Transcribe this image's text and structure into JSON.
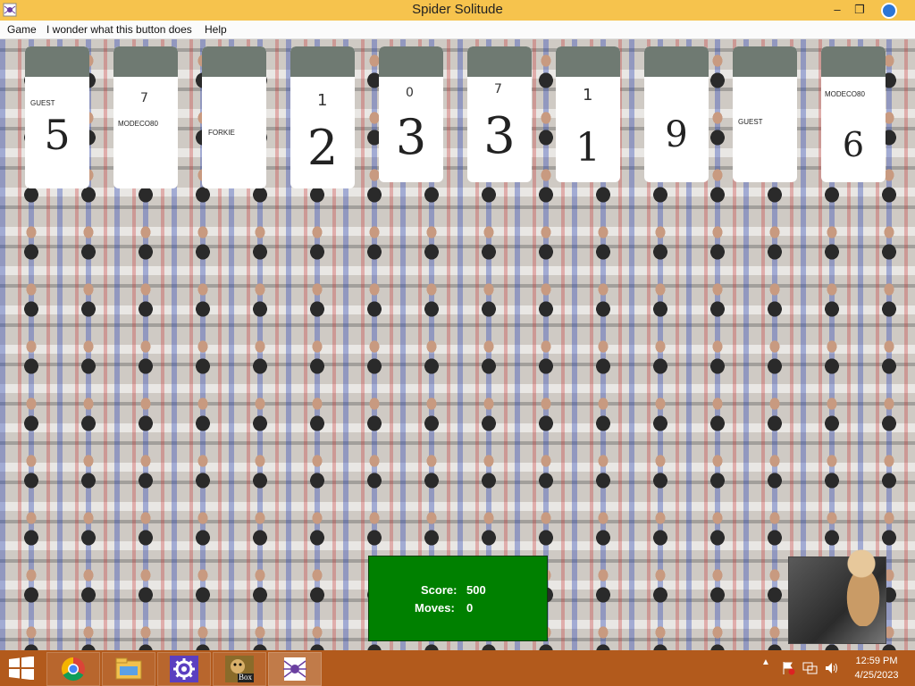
{
  "window": {
    "title": "Spider Solitude",
    "minimize": "‒",
    "maximize": "❐"
  },
  "menu": {
    "items": [
      "Game",
      "I wonder what this button does",
      "Help"
    ]
  },
  "cards": [
    {
      "name": "GUEST",
      "number": "5",
      "top_mark": ""
    },
    {
      "name": "MODECO80",
      "number": "",
      "top_mark": "7"
    },
    {
      "name": "FORKIE",
      "number": "",
      "top_mark": ""
    },
    {
      "name": "",
      "number": "2",
      "top_mark": "1"
    },
    {
      "name": "",
      "number": "3",
      "top_mark": "0"
    },
    {
      "name": "",
      "number": "3",
      "top_mark": "7"
    },
    {
      "name": "",
      "number": "1",
      "top_mark": "1"
    },
    {
      "name": "",
      "number": "9",
      "top_mark": ""
    },
    {
      "name": "GUEST",
      "number": "",
      "top_mark": ""
    },
    {
      "name": "MODECO80",
      "number": "6",
      "top_mark": ""
    }
  ],
  "score": {
    "score_label": "Score:",
    "score_value": "500",
    "moves_label": "Moves:",
    "moves_value": "0"
  },
  "taskbar": {
    "apps": [
      {
        "icon": "chrome-icon"
      },
      {
        "icon": "file-explorer-icon"
      },
      {
        "icon": "settings-icon"
      },
      {
        "icon": "box-app-icon",
        "label": "Box"
      },
      {
        "icon": "spider-solitude-icon"
      }
    ],
    "time": "12:59 PM",
    "date": "4/25/2023"
  },
  "colors": {
    "titlebar": "#f6c34d",
    "taskbar": "#b25a1c",
    "score_panel": "#008000",
    "card_back": "#6f7a72"
  }
}
